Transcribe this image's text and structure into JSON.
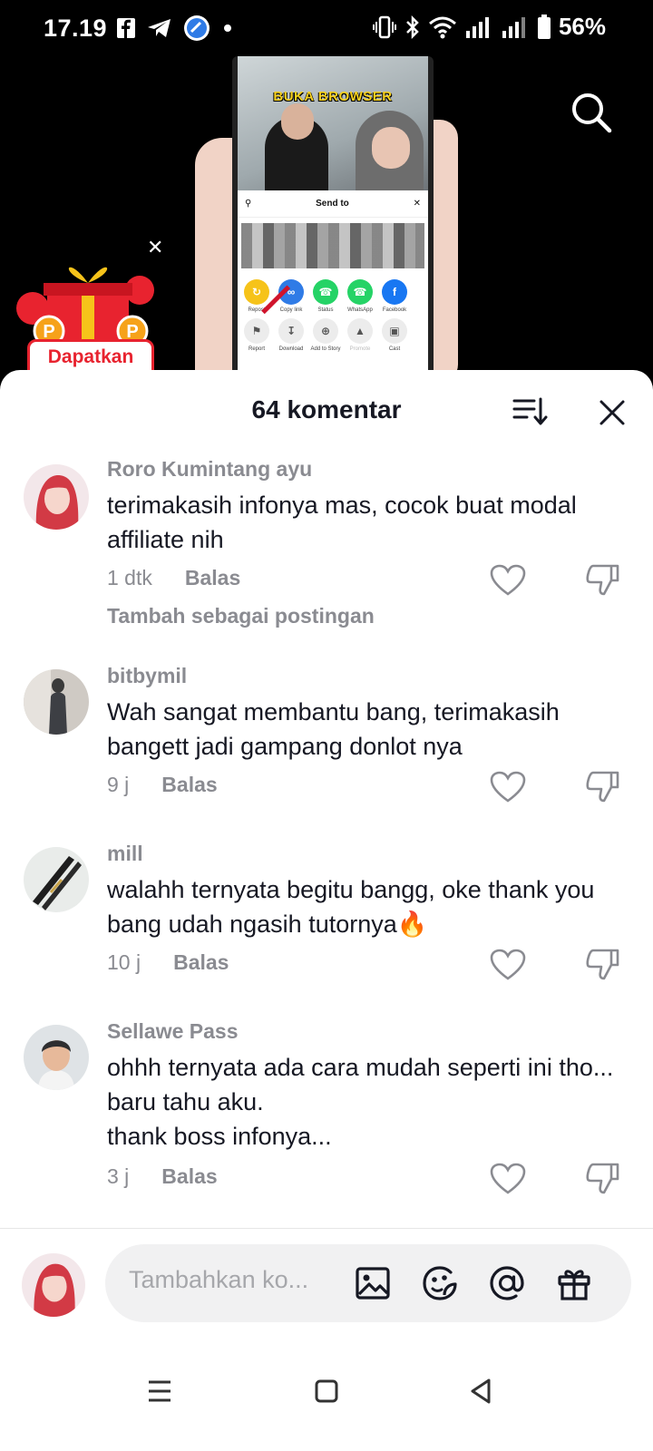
{
  "status_bar": {
    "time": "17.19",
    "left_icons": [
      "facebook-icon",
      "telegram-icon",
      "app-icon",
      "dot-icon"
    ],
    "right_icons": [
      "vibrate-icon",
      "bluetooth-icon",
      "wifi-icon",
      "signal-icon",
      "signal-icon",
      "battery-icon"
    ],
    "battery": "56%"
  },
  "video": {
    "inner_title": "BUKA BROWSER",
    "share_sheet_title": "Send to",
    "share_apps_row1": [
      "Repost",
      "Copy link",
      "Status",
      "WhatsApp",
      "Facebook"
    ],
    "share_apps_row2": [
      "Report",
      "Download",
      "Add to Story",
      "Promote",
      "Cast"
    ],
    "promo_label": "Dapatkan Reward"
  },
  "comments_sheet": {
    "title": "64 komentar",
    "comments": [
      {
        "user": "Roro Kumintang ayu",
        "text": "terimakasih infonya mas, cocok buat modal affiliate nih",
        "time": "1 dtk",
        "reply": "Balas",
        "extra": "Tambah sebagai postingan"
      },
      {
        "user": "bitbymil",
        "text": "Wah sangat membantu bang, terimakasih bangett jadi gampang donlot nya",
        "time": "9 j",
        "reply": "Balas"
      },
      {
        "user": "mill",
        "text": "walahh ternyata begitu bangg, oke thank you bang udah ngasih tutornya🔥",
        "time": "10 j",
        "reply": "Balas"
      },
      {
        "user": "Sellawe Pass",
        "text": "ohhh ternyata ada cara mudah seperti ini tho... baru tahu aku.\nthank boss infonya...",
        "time": "3 j",
        "reply": "Balas"
      }
    ],
    "composer_placeholder": "Tambahkan ko..."
  },
  "colors": {
    "text_primary": "#161823",
    "text_secondary": "#8a8b91",
    "promo_red": "#e8232f",
    "composer_bg": "#f1f1f2"
  }
}
